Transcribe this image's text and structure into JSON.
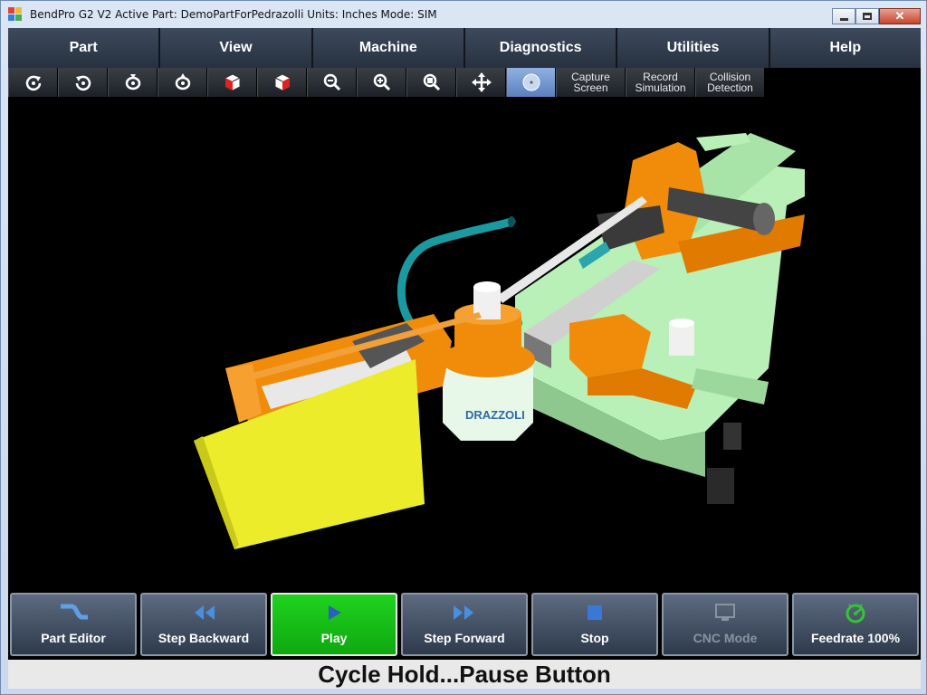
{
  "window": {
    "title": "BendPro G2 V2  Active Part: DemoPartForPedrazolli  Units: Inches  Mode: SIM",
    "controls": [
      "minimize-icon",
      "maximize-icon",
      "close-icon"
    ]
  },
  "menu": {
    "items": [
      {
        "label": "Part"
      },
      {
        "label": "View"
      },
      {
        "label": "Machine"
      },
      {
        "label": "Diagnostics"
      },
      {
        "label": "Utilities"
      },
      {
        "label": "Help"
      }
    ]
  },
  "toolbar": {
    "icon_tools": [
      "rotate-cw-icon",
      "rotate-ccw-icon",
      "rotate-down-icon",
      "rotate-up-icon",
      "view-cube-left-icon",
      "view-cube-right-icon",
      "zoom-out-icon",
      "zoom-in-icon",
      "zoom-fit-icon",
      "pan-icon",
      "center-icon"
    ],
    "capture": "Capture\nScreen",
    "record": "Record\nSimulation",
    "collision": "Collision\nDetection",
    "capture_l1": "Capture",
    "capture_l2": "Screen",
    "record_l1": "Record",
    "record_l2": "Simulation",
    "collision_l1": "Collision",
    "collision_l2": "Detection"
  },
  "viewport": {
    "bend_die_label": "DRAZZOLI",
    "colors": {
      "machine_orange": "#f08c0a",
      "base_green": "#b8f0b8",
      "guard_yellow": "#ecec2a",
      "tube_teal": "#1a9aa0"
    }
  },
  "buttons": {
    "part_editor": "Part Editor",
    "step_backward": "Step Backward",
    "play": "Play",
    "step_forward": "Step Forward",
    "stop": "Stop",
    "cnc_mode": "CNC Mode",
    "feedrate": "Feedrate 100%"
  },
  "status": {
    "message": "Cycle Hold...Pause Button"
  }
}
